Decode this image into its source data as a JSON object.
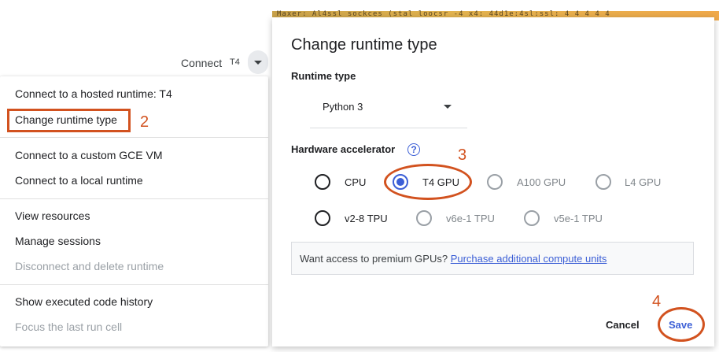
{
  "toolbar": {
    "connect_label": "Connect",
    "connect_badge": "T4"
  },
  "menu": {
    "items": [
      {
        "label": "Connect to a hosted runtime: T4",
        "enabled": true
      },
      {
        "label": "Change runtime type",
        "enabled": true
      },
      {
        "label": "Connect to a custom GCE VM",
        "enabled": true
      },
      {
        "label": "Connect to a local runtime",
        "enabled": true
      },
      {
        "label": "View resources",
        "enabled": true
      },
      {
        "label": "Manage sessions",
        "enabled": true
      },
      {
        "label": "Disconnect and delete runtime",
        "enabled": false
      },
      {
        "label": "Show executed code history",
        "enabled": true
      },
      {
        "label": "Focus the last run cell",
        "enabled": false
      }
    ]
  },
  "annotations": {
    "step2": "2",
    "step3": "3",
    "step4": "4",
    "color": "#d2521f"
  },
  "background": {
    "code_fragment": "Maxer: Al4ssl sockces (stal loocsr -4 x4: 44d1e:4sl:ssl: 4 4 4 4 4"
  },
  "dialog": {
    "title": "Change runtime type",
    "runtime_type_label": "Runtime type",
    "runtime_type_value": "Python 3",
    "hardware_label": "Hardware accelerator",
    "help_icon_glyph": "?",
    "accelerators": [
      {
        "label": "CPU",
        "selected": false,
        "enabled": true
      },
      {
        "label": "T4 GPU",
        "selected": true,
        "enabled": true
      },
      {
        "label": "A100 GPU",
        "selected": false,
        "enabled": false
      },
      {
        "label": "L4 GPU",
        "selected": false,
        "enabled": false
      },
      {
        "label": "v2-8 TPU",
        "selected": false,
        "enabled": true
      },
      {
        "label": "v6e-1 TPU",
        "selected": false,
        "enabled": false
      },
      {
        "label": "v5e-1 TPU",
        "selected": false,
        "enabled": false
      }
    ],
    "premium_text": "Want access to premium GPUs?",
    "premium_link": "Purchase additional compute units",
    "cancel_label": "Cancel",
    "save_label": "Save"
  },
  "colors": {
    "accent": "#3c5fd6",
    "annotation": "#d2521f"
  }
}
